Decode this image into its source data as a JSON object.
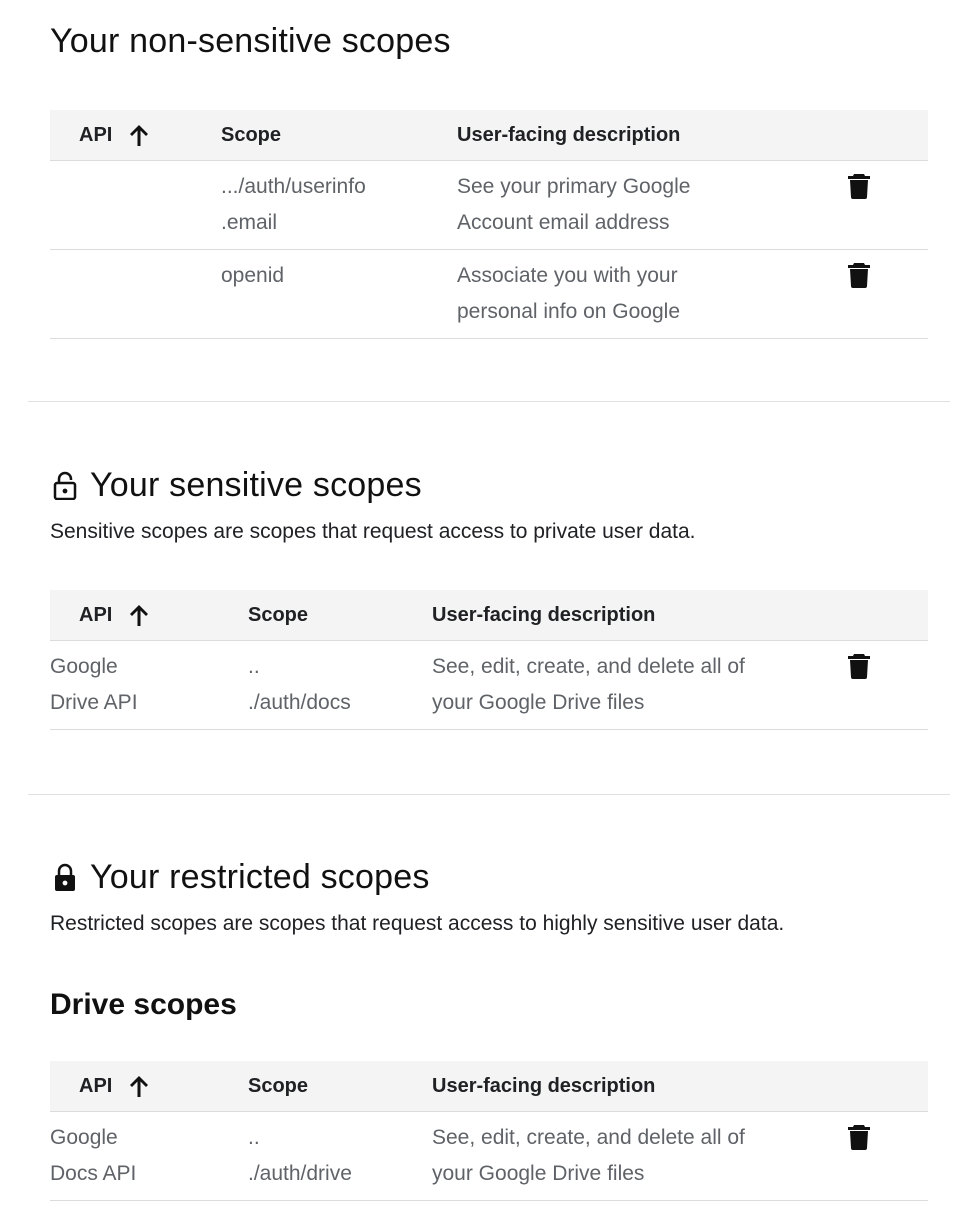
{
  "non_sensitive": {
    "title": "Your non-sensitive scopes",
    "headers": {
      "api": "API",
      "scope": "Scope",
      "description": "User-facing description"
    },
    "rows": [
      {
        "api": "",
        "scope_line1": ".../auth/userinfo",
        "scope_line2": ".email",
        "desc_line1": "See your primary Google",
        "desc_line2": "Account email address"
      },
      {
        "api": "",
        "scope_line1": "openid",
        "scope_line2": "",
        "desc_line1": "Associate you with your",
        "desc_line2": "personal info on Google"
      }
    ]
  },
  "sensitive": {
    "title": "Your sensitive scopes",
    "subtitle": "Sensitive scopes are scopes that request access to private user data.",
    "headers": {
      "api": "API",
      "scope": "Scope",
      "description": "User-facing description"
    },
    "rows": [
      {
        "api_line1": "Google",
        "api_line2": "Drive API",
        "scope_line1": "..",
        "scope_line2": "./auth/docs",
        "desc_line1": "See, edit, create, and delete all of",
        "desc_line2": "your Google Drive files"
      }
    ]
  },
  "restricted": {
    "title": "Your restricted scopes",
    "subtitle": "Restricted scopes are scopes that request access to highly sensitive user data.",
    "drive_heading": "Drive scopes",
    "headers": {
      "api": "API",
      "scope": "Scope",
      "description": "User-facing description"
    },
    "rows": [
      {
        "api_line1": "Google",
        "api_line2": "Docs API",
        "scope_line1": "..",
        "scope_line2": "./auth/drive",
        "desc_line1": "See, edit, create, and delete all of",
        "desc_line2": "your Google Drive files"
      }
    ]
  },
  "icons": {
    "sort": "arrow-up-icon",
    "delete": "trash-icon",
    "lock_open": "lock-open-icon",
    "lock": "lock-icon"
  }
}
